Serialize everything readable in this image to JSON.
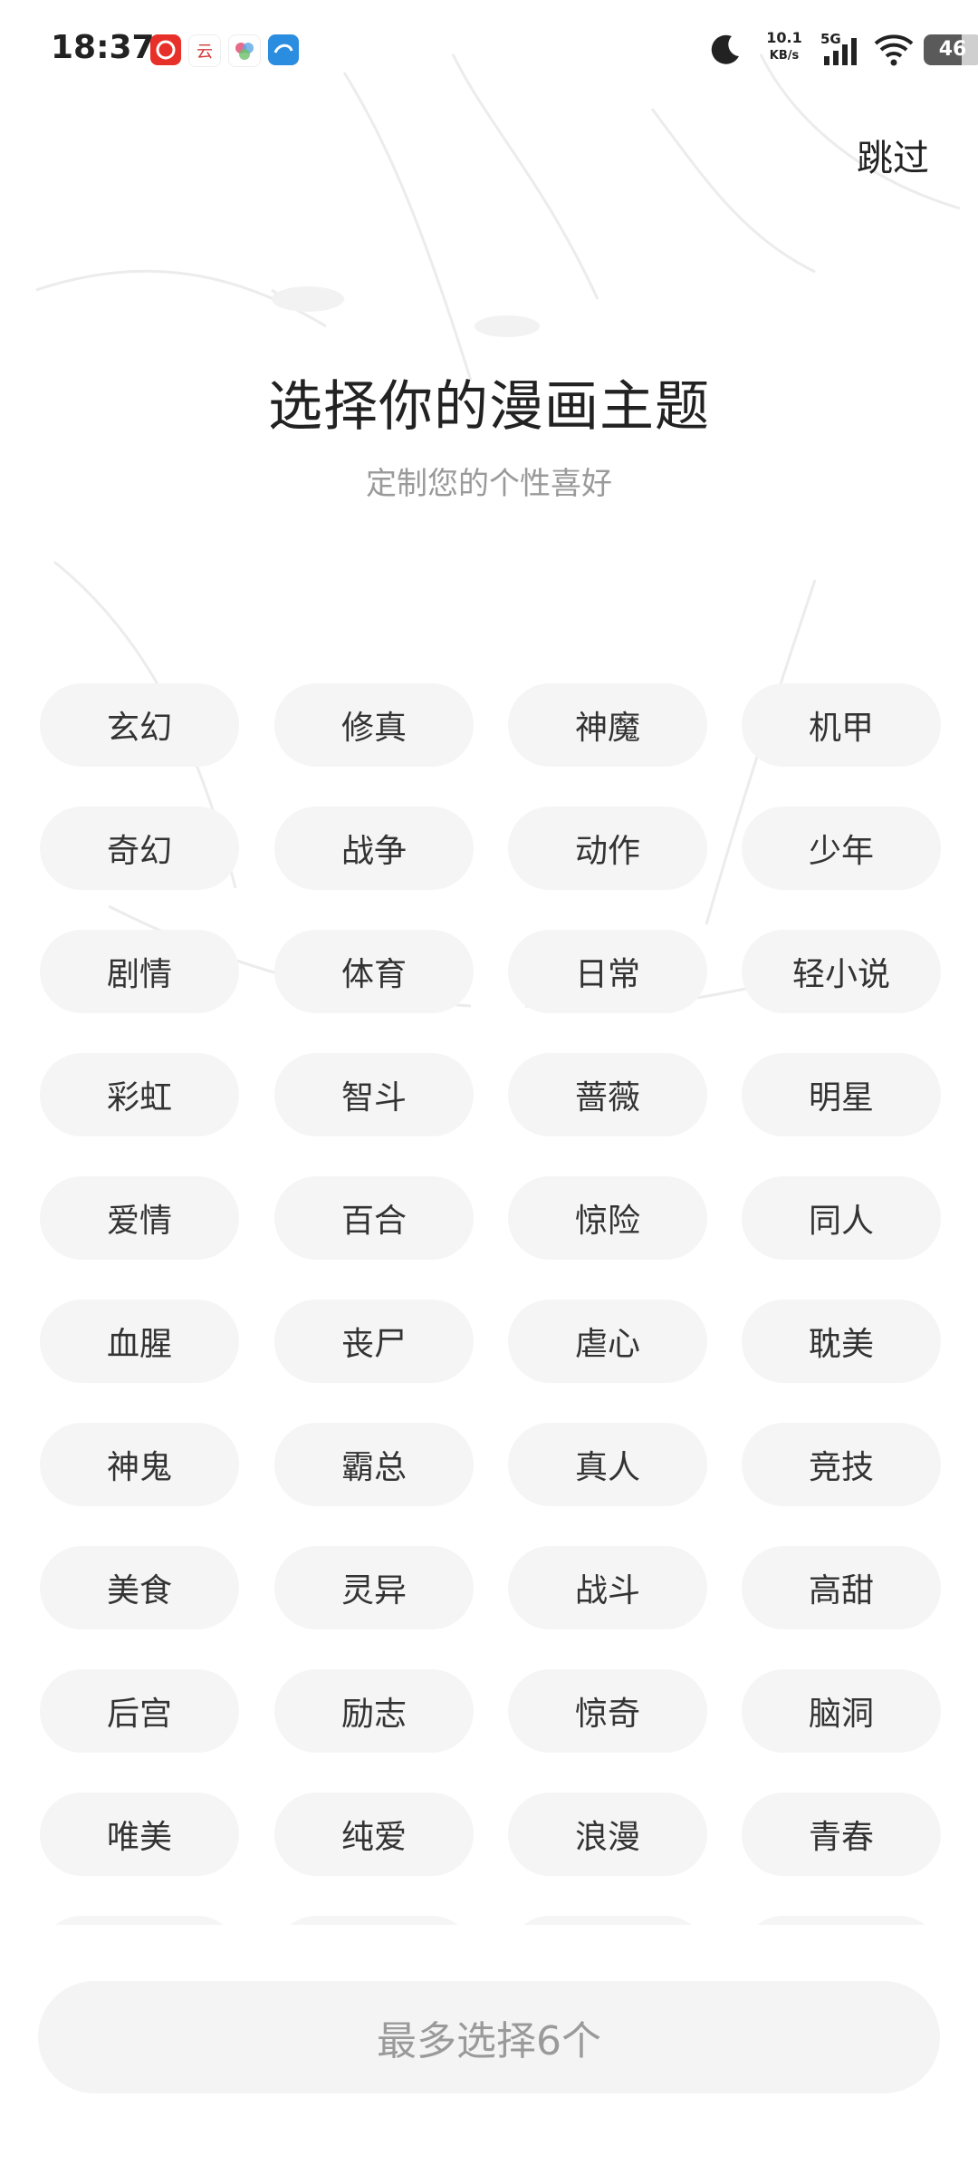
{
  "status_bar": {
    "time": "18:37",
    "app_icons": [
      {
        "name": "netease-music-icon",
        "color": "#e8302a"
      },
      {
        "name": "cloud-app-icon",
        "color": "#d33a3a"
      },
      {
        "name": "photos-app-icon",
        "color": "#5aa8e8"
      },
      {
        "name": "browser-app-icon",
        "color": "#2a8de0"
      }
    ],
    "net_speed_value": "10.1",
    "net_speed_unit": "KB/s",
    "network": "5G",
    "battery": "46"
  },
  "header": {
    "skip_label": "跳过"
  },
  "hero": {
    "title": "选择你的漫画主题",
    "subtitle": "定制您的个性喜好"
  },
  "tags": [
    "玄幻",
    "修真",
    "神魔",
    "机甲",
    "奇幻",
    "战争",
    "动作",
    "少年",
    "剧情",
    "体育",
    "日常",
    "轻小说",
    "彩虹",
    "智斗",
    "蔷薇",
    "明星",
    "爱情",
    "百合",
    "惊险",
    "同人",
    "血腥",
    "丧尸",
    "虐心",
    "耽美",
    "神鬼",
    "霸总",
    "真人",
    "竞技",
    "美食",
    "灵异",
    "战斗",
    "高甜",
    "后宫",
    "励志",
    "惊奇",
    "脑洞",
    "唯美",
    "纯爱",
    "浪漫",
    "青春"
  ],
  "footer": {
    "confirm_label": "最多选择6个"
  },
  "colors": {
    "tag_bg": "#f5f5f5",
    "button_bg": "#f4f4f4",
    "muted_text": "#9a9a9a"
  }
}
